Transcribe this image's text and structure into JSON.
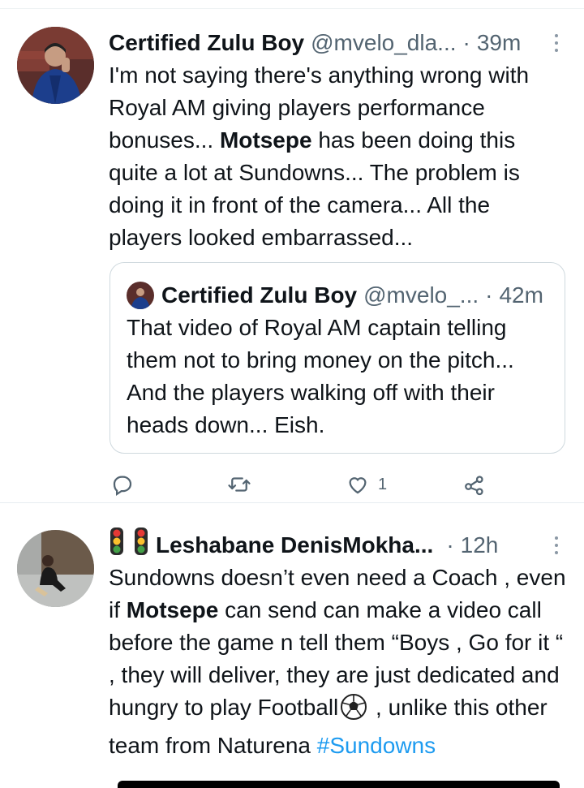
{
  "tweets": [
    {
      "author": "Certified Zulu Boy",
      "handle": "@mvelo_dla...",
      "separator": "·",
      "time": "39m",
      "text": {
        "part1": "I'm not saying there's anything wrong with Royal AM giving players performance bonuses... ",
        "bold": "Motsepe",
        "part2": " has been doing this quite a lot at Sundowns... The problem is doing it in front of the camera... All the players looked embarrassed..."
      },
      "quote": {
        "author": "Certified Zulu Boy",
        "handle": "@mvelo_...",
        "separator": "·",
        "time": "42m",
        "text": "That video of Royal AM captain telling them not to bring money on the pitch... And the players walking off with their heads down... Eish."
      },
      "actions": {
        "reply_icon": "reply-icon",
        "retweet_icon": "retweet-icon",
        "like_icon": "heart-icon",
        "like_count": "1",
        "share_icon": "share-icon"
      }
    },
    {
      "author": "Leshabane DenisMokha...",
      "author_prefix_icons": [
        "traffic-light-icon",
        "traffic-light-icon"
      ],
      "separator": "·",
      "time": "12h",
      "text": {
        "part1": "Sundowns doesn’t even need a Coach , even if ",
        "bold": "Motsepe",
        "part2": " can send can make a video call before the game n tell them “Boys , Go for it “ , they will deliver, they are  just dedicated and hungry to play Football",
        "part3": " , unlike this other team from Naturena ",
        "hashtag": "#Sundowns"
      }
    }
  ],
  "colors": {
    "text": "#0f1419",
    "muted": "#536471",
    "link": "#1d9bf0",
    "border": "#cfd9de"
  }
}
